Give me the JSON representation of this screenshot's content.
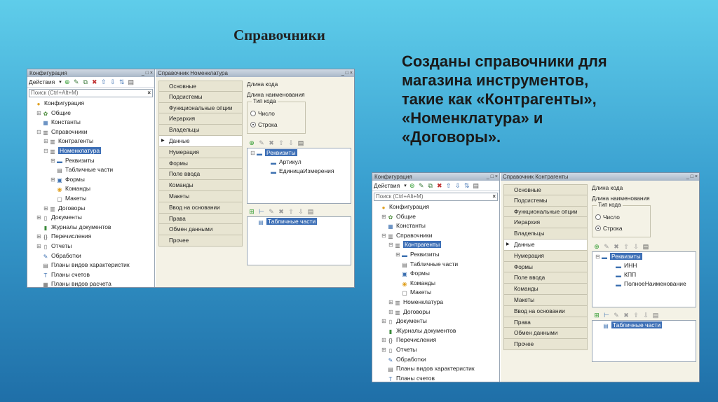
{
  "slide": {
    "title": "Справочники",
    "text_lines": [
      "Созданы справочники для",
      "магазина инструментов,",
      "такие как «Контрагенты»,",
      "«Номенклатура» и",
      "«Договоры»."
    ]
  },
  "shot1": {
    "left_title": "Конфигурация",
    "right_title": "Справочник Номенклатура",
    "actions_label": "Действия",
    "search_placeholder": "Поиск (Ctrl+Alt+M)",
    "tree": [
      {
        "label": "Конфигурация",
        "icon": "config-icon",
        "level": 0,
        "exp": ""
      },
      {
        "label": "Общие",
        "icon": "general-icon",
        "level": 1,
        "exp": "⊕"
      },
      {
        "label": "Константы",
        "icon": "constants-icon",
        "level": 1,
        "exp": ""
      },
      {
        "label": "Справочники",
        "icon": "catalog-icon",
        "level": 1,
        "exp": "⊖"
      },
      {
        "label": "Контрагенты",
        "icon": "catalog-icon",
        "level": 2,
        "exp": "⊕"
      },
      {
        "label": "Номенклатура",
        "icon": "catalog-icon",
        "level": 2,
        "exp": "⊖",
        "selected": true
      },
      {
        "label": "Реквизиты",
        "icon": "attribute-icon",
        "level": 3,
        "exp": "⊕"
      },
      {
        "label": "Табличные части",
        "icon": "table-icon",
        "level": 3,
        "exp": ""
      },
      {
        "label": "Формы",
        "icon": "form-icon",
        "level": 3,
        "exp": "⊕"
      },
      {
        "label": "Команды",
        "icon": "command-icon",
        "level": 3,
        "exp": ""
      },
      {
        "label": "Макеты",
        "icon": "template-icon",
        "level": 3,
        "exp": ""
      },
      {
        "label": "Договоры",
        "icon": "catalog-icon",
        "level": 2,
        "exp": "⊕"
      },
      {
        "label": "Документы",
        "icon": "document-icon",
        "level": 1,
        "exp": "⊕"
      },
      {
        "label": "Журналы документов",
        "icon": "journal-icon",
        "level": 1,
        "exp": ""
      },
      {
        "label": "Перечисления",
        "icon": "enum-icon",
        "level": 1,
        "exp": "⊕"
      },
      {
        "label": "Отчеты",
        "icon": "report-icon",
        "level": 1,
        "exp": "⊕"
      },
      {
        "label": "Обработки",
        "icon": "processing-icon",
        "level": 1,
        "exp": ""
      },
      {
        "label": "Планы видов характеристик",
        "icon": "chart-types-icon",
        "level": 1,
        "exp": ""
      },
      {
        "label": "Планы счетов",
        "icon": "accounts-icon",
        "level": 1,
        "exp": ""
      },
      {
        "label": "Планы видов расчета",
        "icon": "calc-types-icon",
        "level": 1,
        "exp": ""
      }
    ],
    "tabs": [
      "Основные",
      "Подсистемы",
      "Функциональные опции",
      "Иерархия",
      "Владельцы",
      "Данные",
      "Нумерация",
      "Формы",
      "Поле ввода",
      "Команды",
      "Макеты",
      "Ввод на основании",
      "Права",
      "Обмен данными",
      "Прочее"
    ],
    "active_tab": 5,
    "code_length": "Длина кода",
    "name_length": "Длина наименования",
    "code_type": "Тип кода",
    "radio_number": "Число",
    "radio_string": "Строка",
    "attributes_root": "Реквизиты",
    "attributes": [
      "Артикул",
      "ЕдиницаИзмерения"
    ],
    "tabular_sections": "Табличные части"
  },
  "shot2": {
    "left_title": "Конфигурация",
    "right_title": "Справочник Контрагенты",
    "actions_label": "Действия",
    "search_placeholder": "Поиск (Ctrl+Alt+M)",
    "tree": [
      {
        "label": "Конфигурация",
        "icon": "config-icon",
        "level": 0,
        "exp": ""
      },
      {
        "label": "Общие",
        "icon": "general-icon",
        "level": 1,
        "exp": "⊕"
      },
      {
        "label": "Константы",
        "icon": "constants-icon",
        "level": 1,
        "exp": ""
      },
      {
        "label": "Справочники",
        "icon": "catalog-icon",
        "level": 1,
        "exp": "⊖"
      },
      {
        "label": "Контрагенты",
        "icon": "catalog-icon",
        "level": 2,
        "exp": "⊖",
        "selected": true
      },
      {
        "label": "Реквизиты",
        "icon": "attribute-icon",
        "level": 3,
        "exp": "⊕"
      },
      {
        "label": "Табличные части",
        "icon": "table-icon",
        "level": 3,
        "exp": ""
      },
      {
        "label": "Формы",
        "icon": "form-icon",
        "level": 3,
        "exp": ""
      },
      {
        "label": "Команды",
        "icon": "command-icon",
        "level": 3,
        "exp": ""
      },
      {
        "label": "Макеты",
        "icon": "template-icon",
        "level": 3,
        "exp": ""
      },
      {
        "label": "Номенклатура",
        "icon": "catalog-icon",
        "level": 2,
        "exp": "⊕"
      },
      {
        "label": "Договоры",
        "icon": "catalog-icon",
        "level": 2,
        "exp": "⊕"
      },
      {
        "label": "Документы",
        "icon": "document-icon",
        "level": 1,
        "exp": "⊕"
      },
      {
        "label": "Журналы документов",
        "icon": "journal-icon",
        "level": 1,
        "exp": ""
      },
      {
        "label": "Перечисления",
        "icon": "enum-icon",
        "level": 1,
        "exp": "⊕"
      },
      {
        "label": "Отчеты",
        "icon": "report-icon",
        "level": 1,
        "exp": "⊕"
      },
      {
        "label": "Обработки",
        "icon": "processing-icon",
        "level": 1,
        "exp": ""
      },
      {
        "label": "Планы видов характеристик",
        "icon": "chart-types-icon",
        "level": 1,
        "exp": ""
      },
      {
        "label": "Планы счетов",
        "icon": "accounts-icon",
        "level": 1,
        "exp": ""
      }
    ],
    "tabs": [
      "Основные",
      "Подсистемы",
      "Функциональные опции",
      "Иерархия",
      "Владельцы",
      "Данные",
      "Нумерация",
      "Формы",
      "Поле ввода",
      "Команды",
      "Макеты",
      "Ввод на основании",
      "Права",
      "Обмен данными",
      "Прочее"
    ],
    "active_tab": 5,
    "code_length": "Длина кода",
    "name_length": "Длина наименования",
    "code_type": "Тип кода",
    "radio_number": "Число",
    "radio_string": "Строка",
    "attributes_root": "Реквизиты",
    "attributes": [
      "ИНН",
      "КПП",
      "ПолноеНаименование"
    ],
    "tabular_sections": "Табличные части"
  },
  "colors": {
    "selection": "#3d6fb6",
    "panel": "#f4f2e6",
    "tab": "#e8e5d2"
  }
}
